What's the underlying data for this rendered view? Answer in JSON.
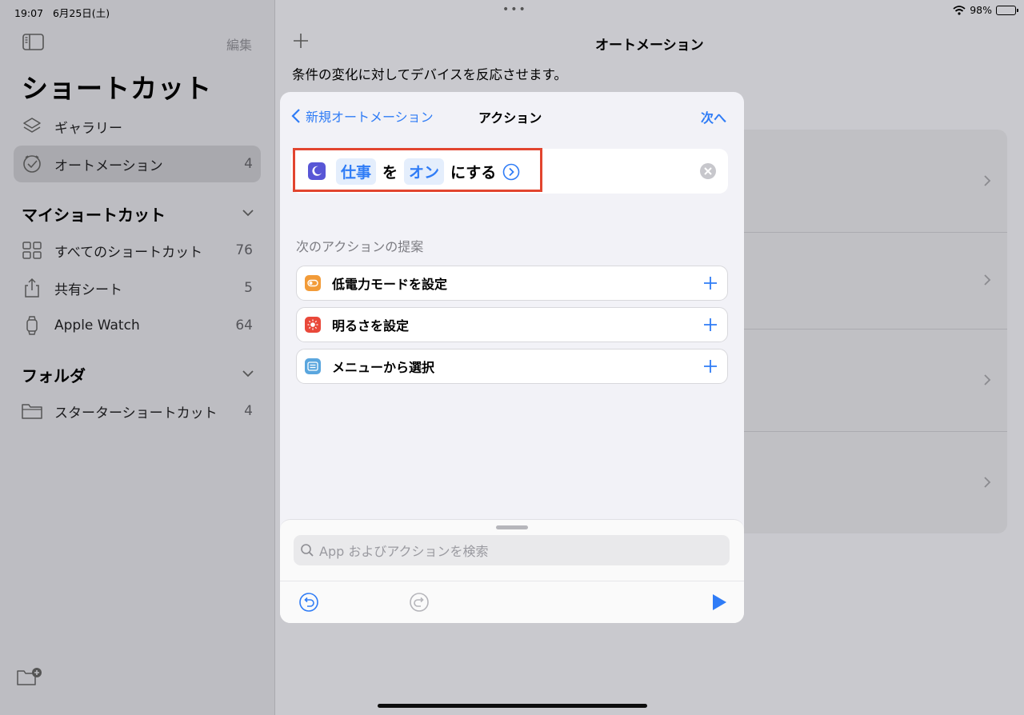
{
  "status": {
    "time": "19:07",
    "date": "6月25日(土)",
    "battery": "98%",
    "dots": "•••"
  },
  "sidebar": {
    "edit_label": "編集",
    "title": "ショートカット",
    "items": [
      {
        "label": "ギャラリー",
        "count": ""
      },
      {
        "label": "オートメーション",
        "count": "4"
      }
    ],
    "my_shortcuts": {
      "title": "マイショートカット",
      "items": [
        {
          "label": "すべてのショートカット",
          "count": "76"
        },
        {
          "label": "共有シート",
          "count": "5"
        },
        {
          "label": "Apple Watch",
          "count": "64"
        }
      ]
    },
    "folders": {
      "title": "フォルダ",
      "items": [
        {
          "label": "スターターショートカット",
          "count": "4"
        }
      ]
    }
  },
  "main": {
    "title": "オートメーション",
    "description": "条件の変化に対してデバイスを反応させます。"
  },
  "modal": {
    "back_label": "新規オートメーション",
    "title": "アクション",
    "next_label": "次へ",
    "action": {
      "focus_token": "仕事",
      "particle": "を",
      "state_token": "オン",
      "verb": "にする"
    },
    "suggestions_title": "次のアクションの提案",
    "suggestions": [
      {
        "label": "低電力モードを設定",
        "color": "#f29b38"
      },
      {
        "label": "明るさを設定",
        "color": "#e9483a"
      },
      {
        "label": "メニューから選択",
        "color": "#5aa6de"
      }
    ],
    "search_placeholder": "App およびアクションを検索"
  },
  "colors": {
    "accent": "#2f7cf6",
    "highlight": "#e2452f",
    "focus_icon": "#5856d6"
  }
}
